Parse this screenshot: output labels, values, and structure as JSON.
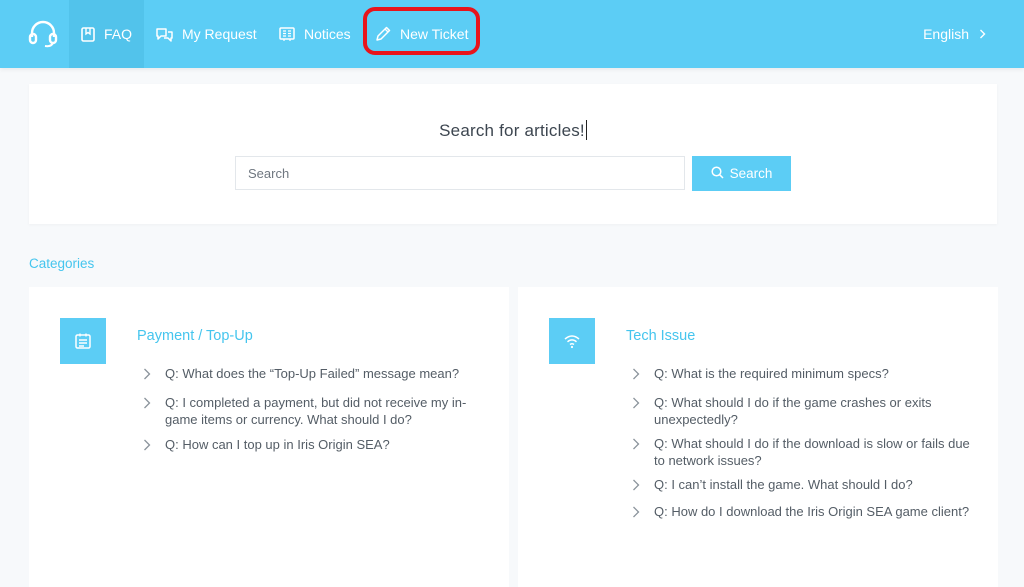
{
  "header": {
    "nav": {
      "faq": "FAQ",
      "my_request": "My Request",
      "notices": "Notices",
      "new_ticket": "New Ticket"
    },
    "language": "English"
  },
  "search": {
    "title": "Search for articles!",
    "placeholder": "Search",
    "button_label": "Search"
  },
  "categories": {
    "label": "Categories",
    "items": [
      {
        "title": "Payment / Top-Up",
        "icon": "calendar-icon",
        "questions": [
          "Q: What does the “Top-Up Failed” message mean?",
          "Q: I completed a payment, but did not receive my in-game items or currency. What should I do?",
          "Q: How can I top up in Iris Origin SEA?"
        ]
      },
      {
        "title": "Tech Issue",
        "icon": "wifi-icon",
        "questions": [
          "Q: What is the required minimum specs?",
          "Q: What should I do if the game crashes or exits unexpectedly?",
          "Q: What should I do if the download is slow or fails due to network issues?",
          "Q: I can’t install the game. What should I do?",
          "Q: How do I download the Iris Origin SEA game client?"
        ]
      }
    ]
  },
  "colors": {
    "accent": "#5ccdf5",
    "highlight": "#e8141b",
    "background": "#f7f9fb"
  }
}
